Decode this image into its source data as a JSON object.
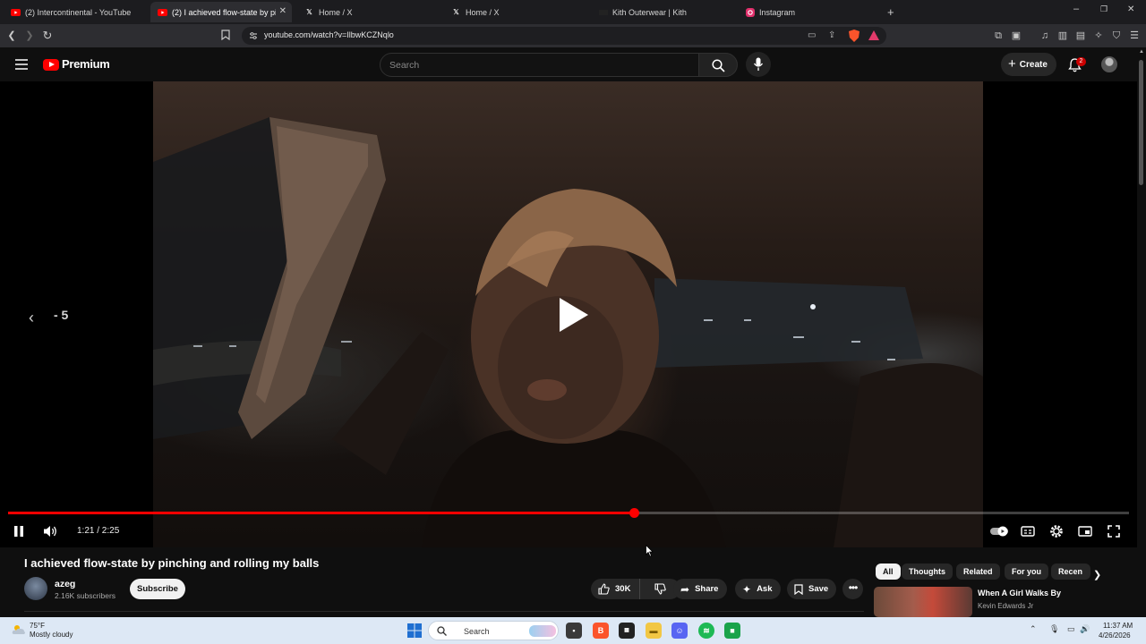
{
  "browser": {
    "tabs": [
      {
        "label": "(2) Intercontinental - YouTube",
        "favicon": "youtube-icon"
      },
      {
        "label": "(2) I achieved flow-state by pinch",
        "favicon": "youtube-icon",
        "active": true
      },
      {
        "label": "Home / X",
        "favicon": "x-icon"
      },
      {
        "label": "Home / X",
        "favicon": "x-icon"
      },
      {
        "label": "Kith Outerwear | Kith",
        "favicon": "kith-icon"
      },
      {
        "label": "Instagram",
        "favicon": "instagram-icon"
      }
    ],
    "new_tab": "+",
    "url": "youtube.com/watch?v=IlbwKCZNqlo"
  },
  "masthead": {
    "logo_text": "Premium",
    "search_placeholder": "Search",
    "create_label": "Create",
    "notification_count": "2"
  },
  "player": {
    "skip_label": "- 5",
    "time": "1:21 / 2:25",
    "progress": 0.558
  },
  "video": {
    "title": "I achieved flow-state by pinching and rolling my balls",
    "channel": "azeg",
    "subscribers": "2.16K subscribers",
    "subscribe_label": "Subscribe",
    "likes": "30K",
    "share_label": "Share",
    "ask_label": "Ask",
    "save_label": "Save"
  },
  "chips": [
    "All",
    "Thoughts",
    "Related",
    "For you",
    "Recen"
  ],
  "recommendation": {
    "title": "When A Girl Walks By",
    "channel": "Kevin Edwards Jr"
  },
  "taskbar": {
    "temperature": "75°F",
    "weather": "Mostly cloudy",
    "search_label": "Search",
    "time": "11:37 AM",
    "date": "4/26/2026"
  },
  "colors": {
    "youtube_red": "#ff0000",
    "background": "#0f0f0f",
    "taskbar": "#dde8f5"
  }
}
